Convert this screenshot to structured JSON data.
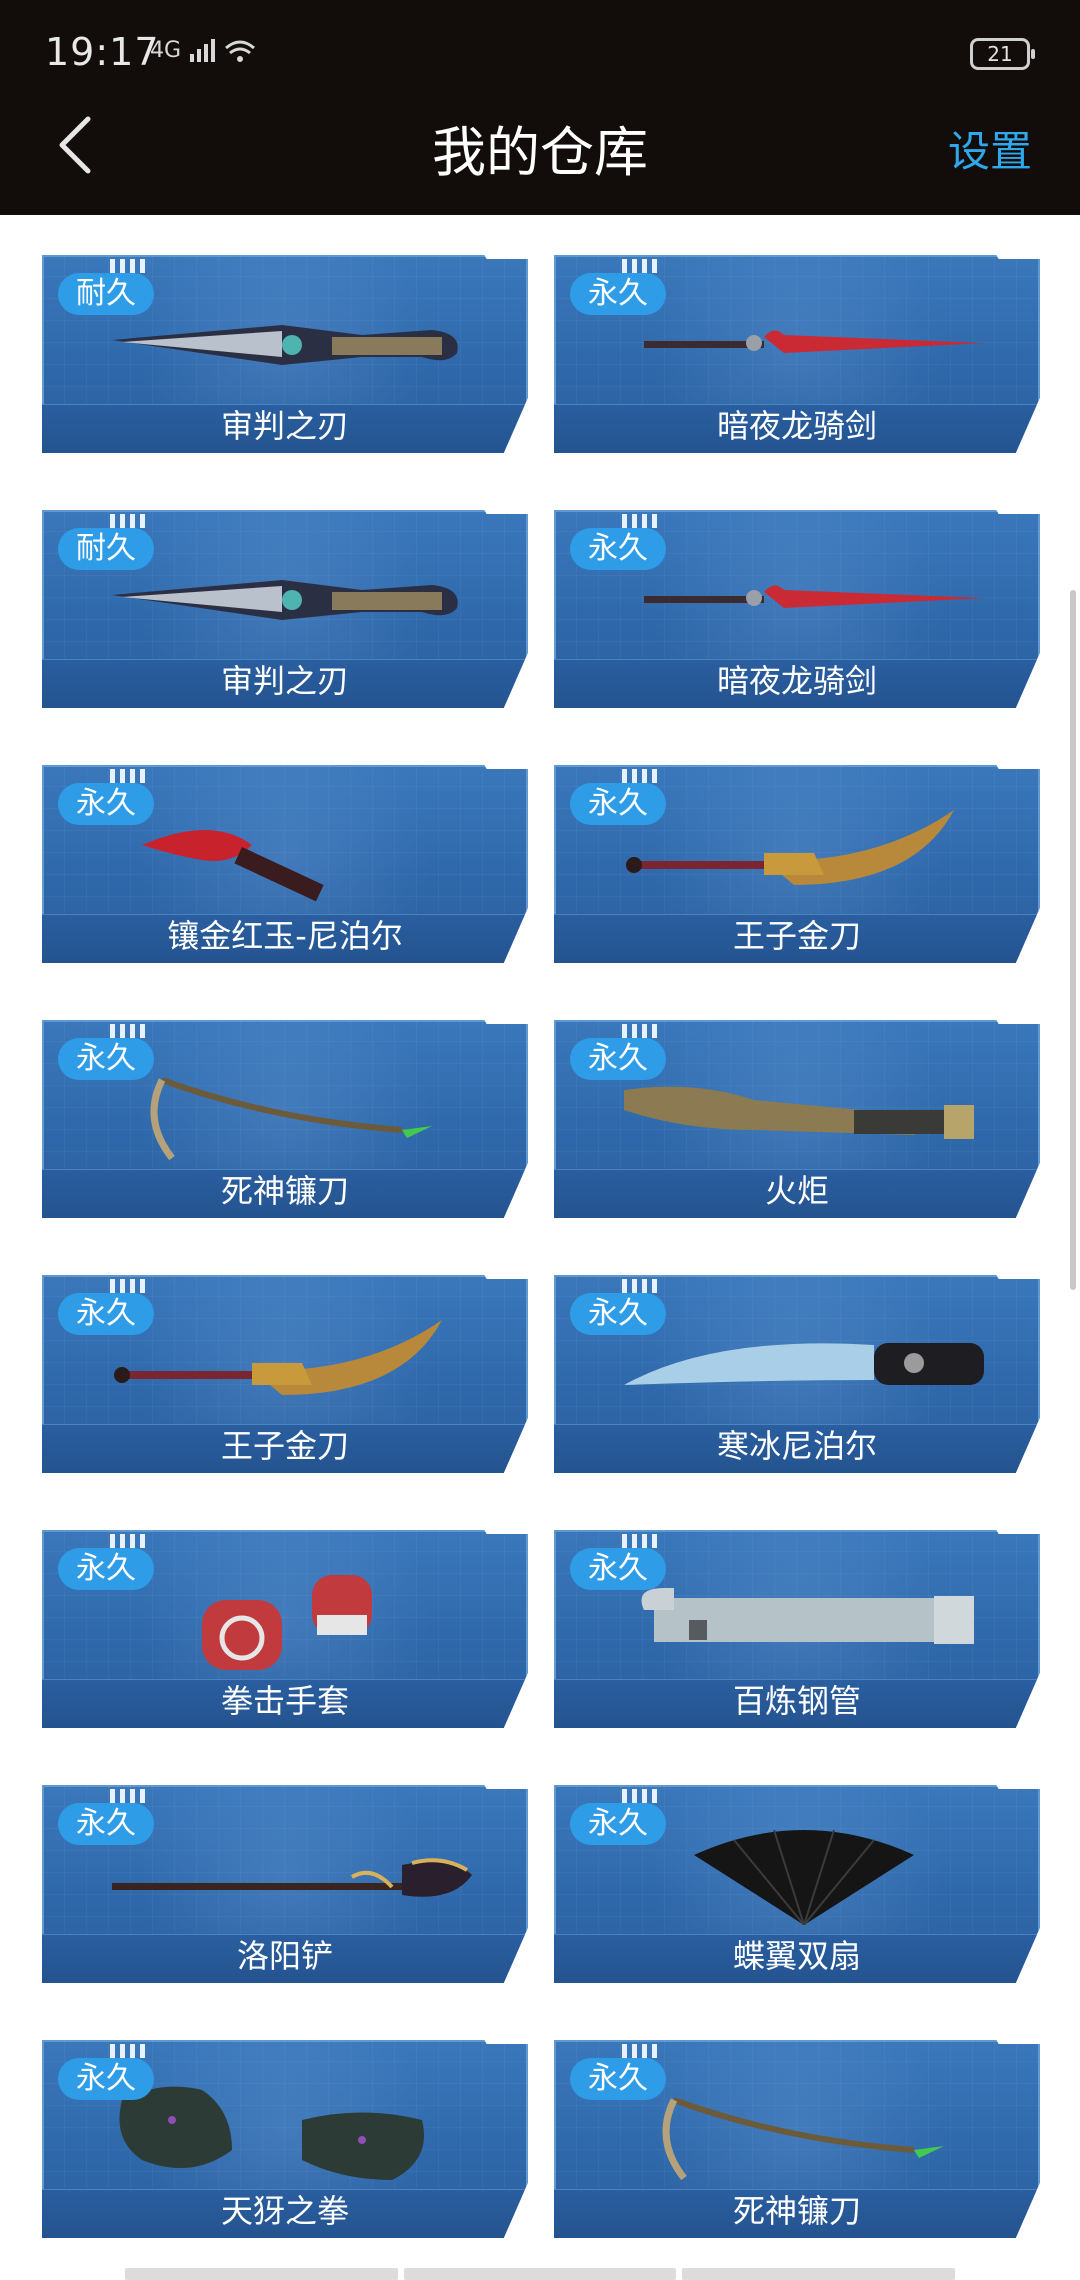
{
  "status": {
    "time": "19:17",
    "network": "4G",
    "battery": "21"
  },
  "header": {
    "title": "我的仓库",
    "settings_label": "设置"
  },
  "items": [
    {
      "tag": "耐久",
      "name": "审判之刃",
      "icon": "dagger-icon"
    },
    {
      "tag": "永久",
      "name": "暗夜龙骑剑",
      "icon": "red-sword-icon"
    },
    {
      "tag": "耐久",
      "name": "审判之刃",
      "icon": "dagger-icon"
    },
    {
      "tag": "永久",
      "name": "暗夜龙骑剑",
      "icon": "red-sword-icon"
    },
    {
      "tag": "永久",
      "name": "镶金红玉-尼泊尔",
      "icon": "kukri-icon"
    },
    {
      "tag": "永久",
      "name": "王子金刀",
      "icon": "golden-blade-icon"
    },
    {
      "tag": "永久",
      "name": "死神镰刀",
      "icon": "scythe-icon"
    },
    {
      "tag": "永久",
      "name": "火炬",
      "icon": "torch-icon"
    },
    {
      "tag": "永久",
      "name": "王子金刀",
      "icon": "golden-blade-icon"
    },
    {
      "tag": "永久",
      "name": "寒冰尼泊尔",
      "icon": "ice-knife-icon"
    },
    {
      "tag": "永久",
      "name": "拳击手套",
      "icon": "boxing-gloves-icon"
    },
    {
      "tag": "永久",
      "name": "百炼钢管",
      "icon": "steel-pipe-icon"
    },
    {
      "tag": "永久",
      "name": "洛阳铲",
      "icon": "spade-icon"
    },
    {
      "tag": "永久",
      "name": "蝶翼双扇",
      "icon": "fan-icon"
    },
    {
      "tag": "永久",
      "name": "天犽之拳",
      "icon": "claw-gloves-icon"
    },
    {
      "tag": "永久",
      "name": "死神镰刀",
      "icon": "scythe-icon"
    }
  ]
}
